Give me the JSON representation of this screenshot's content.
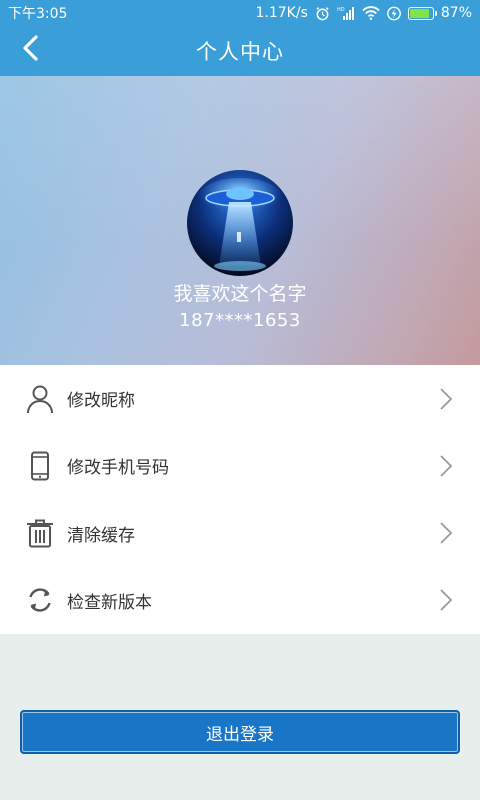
{
  "status_bar": {
    "time": "下午3:05",
    "network_speed": "1.17K/s",
    "battery_percent": "87%",
    "battery_level": 0.87,
    "icons": [
      "alarm-icon",
      "signal-icon",
      "wifi-icon",
      "charging-icon",
      "battery-icon"
    ]
  },
  "header": {
    "title": "个人中心",
    "back_icon": "chevron-left-icon"
  },
  "profile": {
    "name": "我喜欢这个名字",
    "phone": "187****1653",
    "avatar_icon": "ufo-avatar"
  },
  "menu": {
    "items": [
      {
        "label": "修改昵称",
        "icon": "user-icon"
      },
      {
        "label": "修改手机号码",
        "icon": "phone-icon"
      },
      {
        "label": "清除缓存",
        "icon": "trash-icon"
      },
      {
        "label": "检查新版本",
        "icon": "refresh-icon"
      }
    ]
  },
  "logout": {
    "label": "退出登录"
  },
  "colors": {
    "primary": "#3a9fd8",
    "button": "#1976c6",
    "background": "#e8eeec"
  }
}
